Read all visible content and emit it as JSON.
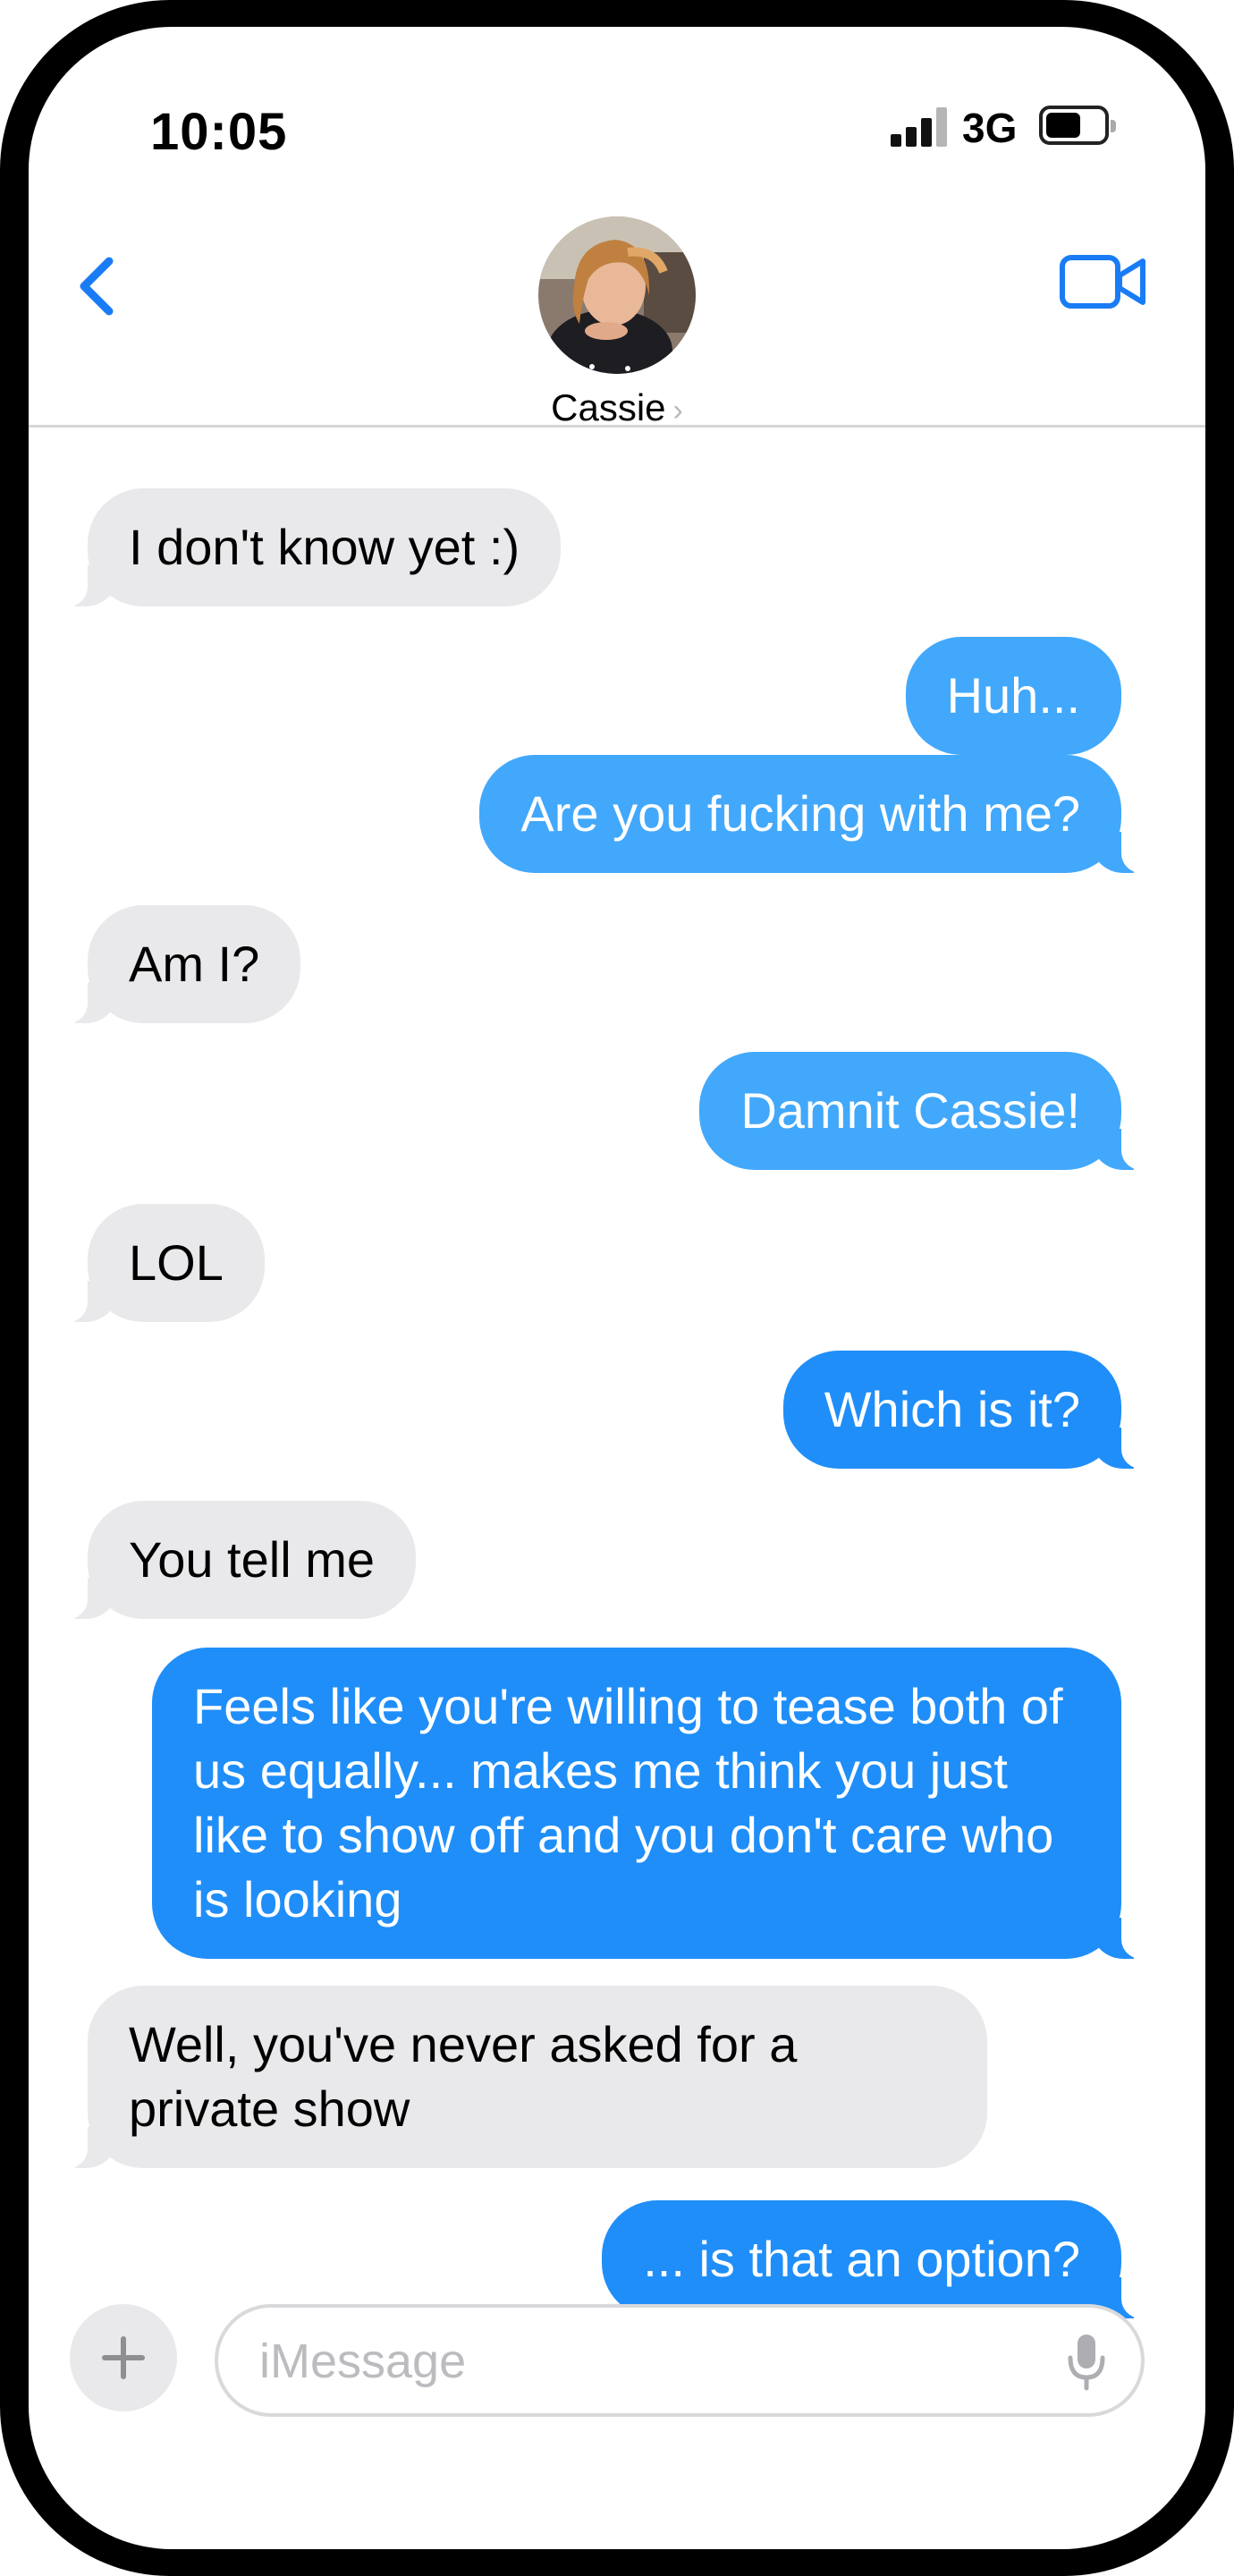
{
  "status_bar": {
    "time": "10:05",
    "network": "3G"
  },
  "header": {
    "contact_name": "Cassie"
  },
  "messages": [
    {
      "direction": "incoming",
      "text": "I don't know yet :)"
    },
    {
      "direction": "outgoing",
      "text": "Huh..."
    },
    {
      "direction": "outgoing",
      "text": "Are you fucking with me?"
    },
    {
      "direction": "incoming",
      "text": "Am I?"
    },
    {
      "direction": "outgoing",
      "text": "Damnit Cassie!"
    },
    {
      "direction": "incoming",
      "text": "LOL"
    },
    {
      "direction": "outgoing",
      "text": "Which is it?"
    },
    {
      "direction": "incoming",
      "text": "You tell me"
    },
    {
      "direction": "outgoing",
      "text": "Feels like you're willing to tease both of us equally... makes me think you just like to show off and you don't care who is looking"
    },
    {
      "direction": "incoming",
      "text": "Well, you've never asked for a private show"
    },
    {
      "direction": "outgoing",
      "text": "... is that an option?"
    }
  ],
  "composer": {
    "placeholder": "iMessage"
  },
  "colors": {
    "outgoing_bubble": "#1f8ef8",
    "outgoing_bubble_light": "#42a8fb",
    "incoming_bubble": "#e9e9eb",
    "accent": "#1a7cf5"
  },
  "icons": [
    "back-chevron-icon",
    "video-camera-icon",
    "plus-icon",
    "microphone-icon",
    "signal-bars-icon",
    "battery-icon"
  ]
}
